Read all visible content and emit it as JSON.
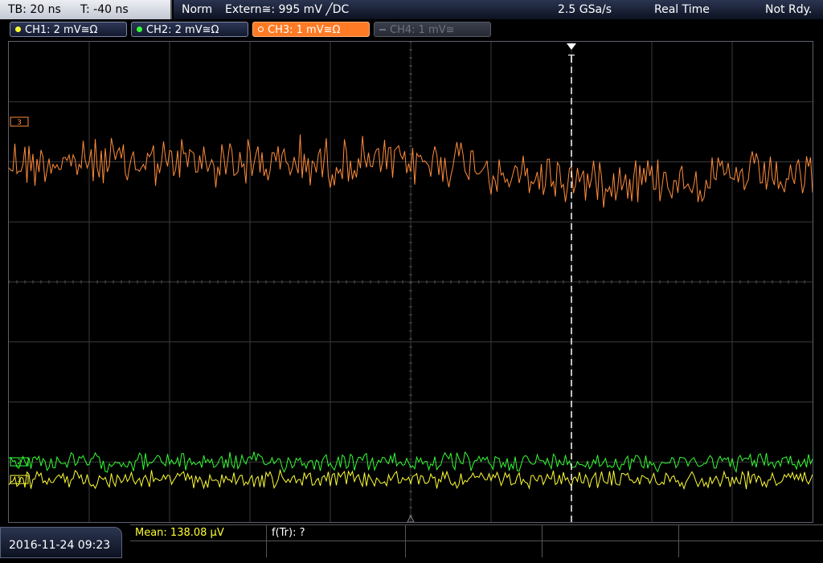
{
  "timebase": {
    "tb": "TB: 20 ns",
    "trigger_time": "T: -40 ns"
  },
  "status": {
    "mode": "Norm",
    "trigger": "Extern≅: 995 mV ╱DC",
    "sample_rate": "2.5 GSa/s",
    "acquisition": "Real Time",
    "state": "Not Rdy."
  },
  "channels": [
    {
      "label": "CH1: 2 mV≅Ω",
      "color": "#ffff33",
      "active": false,
      "enabled": true
    },
    {
      "label": "CH2: 2 mV≅Ω",
      "color": "#33ff33",
      "active": false,
      "enabled": true
    },
    {
      "label": "CH3: 1 mV≅Ω",
      "color": "#ff8c3a",
      "active": true,
      "enabled": true
    },
    {
      "label": "CH4: 1 mV≅",
      "color": "#6d7280",
      "active": false,
      "enabled": false
    }
  ],
  "colors": {
    "ch1": "#ffff33",
    "ch2": "#33ff33",
    "ch3": "#ff8c3a",
    "grid": "#3a3a3a",
    "trigger_line": "#ffffff"
  },
  "markers": {
    "trigger_marker": "T",
    "ch3_marker": "3",
    "ch2_marker": "2",
    "ch1_marker": "1"
  },
  "date": "2016-11-24 09:23",
  "measurements": {
    "mean": "Mean: 138.08 µV",
    "ftr": "f(Tr): ?"
  }
}
